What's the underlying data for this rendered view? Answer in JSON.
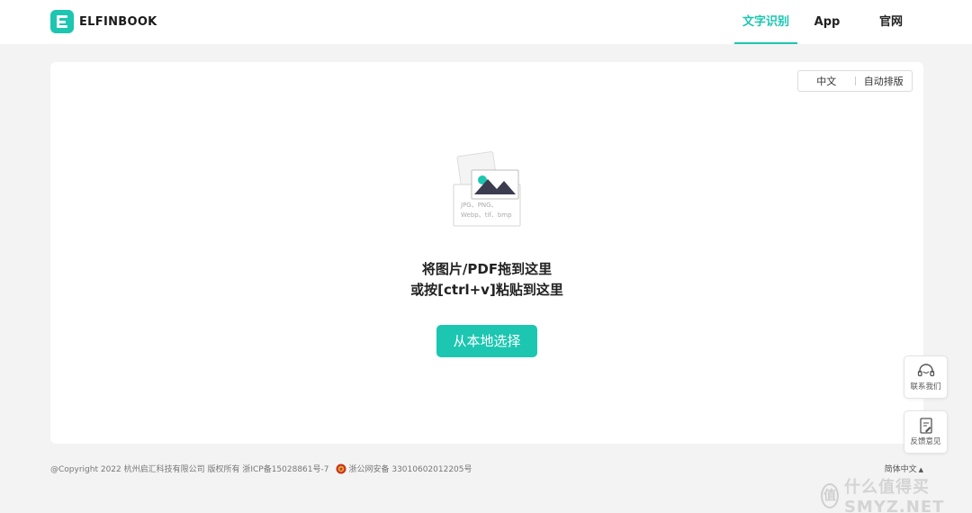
{
  "brand": {
    "name": "ELFINBOOK"
  },
  "nav": [
    {
      "label": "文字识别",
      "active": true
    },
    {
      "label": "App",
      "active": false
    },
    {
      "label": "官网",
      "active": false
    }
  ],
  "toolbar": {
    "lang_option": "中文",
    "layout_option": "自动排版"
  },
  "upload": {
    "formats_line1": "JPG、PNG、",
    "formats_line2": "Webp、tif、bmp",
    "prompt_line1": "将图片/PDF拖到这里",
    "prompt_line2": "或按[ctrl+v]粘贴到这里",
    "select_button": "从本地选择"
  },
  "side": {
    "contact_label": "联系我们",
    "feedback_label": "反馈意见"
  },
  "footer": {
    "copyright": "@Copyright 2022 杭州启汇科技有限公司 版权所有 浙ICP备15028861号-7",
    "police": "浙公网安备 33010602012205号",
    "language": "简体中文"
  },
  "watermark": {
    "icon_char": "值",
    "text": "什么值得买 SMYZ.NET"
  },
  "colors": {
    "accent": "#1cc6b1",
    "background": "#f3f3f3"
  }
}
